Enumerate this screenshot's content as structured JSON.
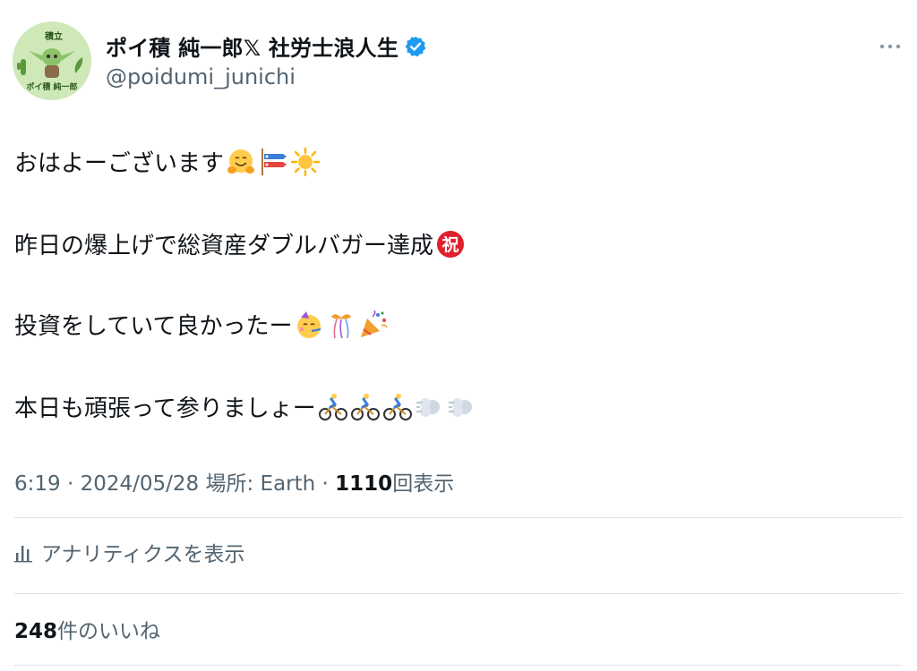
{
  "author": {
    "avatar_text_top": "積立",
    "avatar_text_bottom": "ポイ積 純一郎",
    "display_name": "ポイ積 純一郎𝕏 社労士浪人生",
    "handle": "@poidumi_junichi",
    "verified": true
  },
  "tweet": {
    "lines": [
      {
        "text": "おはよーございます",
        "emojis": [
          "hugging-face-emoji",
          "carp-streamer-emoji",
          "sun-emoji"
        ]
      },
      {
        "text": "昨日の爆上げで総資産ダブルバガー達成",
        "emojis": [
          "congratulations-emoji"
        ]
      },
      {
        "text": "投資をしていて良かったー",
        "emojis": [
          "partying-face-emoji",
          "wrapped-gift-ribbon-emoji",
          "party-popper-emoji"
        ]
      },
      {
        "text": "本日も頑張って参りましょー",
        "emojis": [
          "cyclist-emoji",
          "cyclist-emoji",
          "cyclist-emoji",
          "dash-emoji",
          "dash-emoji"
        ]
      }
    ]
  },
  "meta": {
    "time": "6:19",
    "separator": "·",
    "date": "2024/05/28",
    "location_label": "場所:",
    "location": "Earth",
    "views_count": "1110",
    "views_label": "回表示"
  },
  "analytics": {
    "label": "アナリティクスを表示"
  },
  "likes": {
    "count": "248",
    "label": "件のいいね"
  },
  "colors": {
    "text_primary": "#0f1419",
    "text_secondary": "#536471",
    "verified_blue": "#1d9bf0",
    "divider": "#dfe4e8",
    "avatar_bg": "#cfe8b8"
  }
}
